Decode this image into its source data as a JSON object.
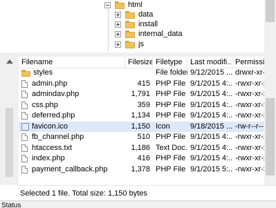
{
  "tree": {
    "items": [
      {
        "label": "html",
        "expanded": true
      },
      {
        "label": "data",
        "expanded": false
      },
      {
        "label": "install",
        "expanded": false
      },
      {
        "label": "internal_data",
        "expanded": false
      },
      {
        "label": "js",
        "expanded": false
      }
    ]
  },
  "columns": {
    "filename": "Filename",
    "filesize": "Filesize",
    "filetype": "Filetype",
    "modified": "Last modifi...",
    "perms": "Permissi..."
  },
  "files": [
    {
      "name": "styles",
      "size": "",
      "type": "File folder",
      "modified": "9/12/2015 ...",
      "perms": "drwxr-xr-x",
      "icon": "folder-icon"
    },
    {
      "name": "admin.php",
      "size": "415",
      "type": "PHP File",
      "modified": "9/1/2015 4:...",
      "perms": "-rwxr-xr-x",
      "icon": "file-icon"
    },
    {
      "name": "admindav.php",
      "size": "1,791",
      "type": "PHP File",
      "modified": "9/1/2015 4:...",
      "perms": "-rwxr-xr-x",
      "icon": "file-icon"
    },
    {
      "name": "css.php",
      "size": "359",
      "type": "PHP File",
      "modified": "9/1/2015 4:...",
      "perms": "-rwxr-xr-x",
      "icon": "file-icon"
    },
    {
      "name": "deferred.php",
      "size": "1,134",
      "type": "PHP File",
      "modified": "9/1/2015 4:...",
      "perms": "-rwxr-xr-x",
      "icon": "file-icon"
    },
    {
      "name": "favicon.ico",
      "size": "1,150",
      "type": "Icon",
      "modified": "9/18/2015 ...",
      "perms": "-rw-r--r--",
      "icon": "image-file-icon"
    },
    {
      "name": "fb_channel.php",
      "size": "510",
      "type": "PHP File",
      "modified": "9/1/2015 4:...",
      "perms": "-rwxr-xr-x",
      "icon": "file-icon"
    },
    {
      "name": "htaccess.txt",
      "size": "1,186",
      "type": "Text Doc...",
      "modified": "9/1/2015 4:...",
      "perms": "-rwxr-xr-x",
      "icon": "file-icon"
    },
    {
      "name": "index.php",
      "size": "416",
      "type": "PHP File",
      "modified": "9/1/2015 4:...",
      "perms": "-rwxr-xr-x",
      "icon": "file-icon"
    },
    {
      "name": "payment_callback.php",
      "size": "1,378",
      "type": "PHP File",
      "modified": "9/1/2015 5:...",
      "perms": "-rwxr-xr-x",
      "icon": "file-icon"
    }
  ],
  "selected_index": 5,
  "selection_status": "Selected 1 file. Total size: 1,150 bytes",
  "status_label": "Status",
  "colors": {
    "selection": "#dde8f8",
    "folder": "#efc35a"
  }
}
